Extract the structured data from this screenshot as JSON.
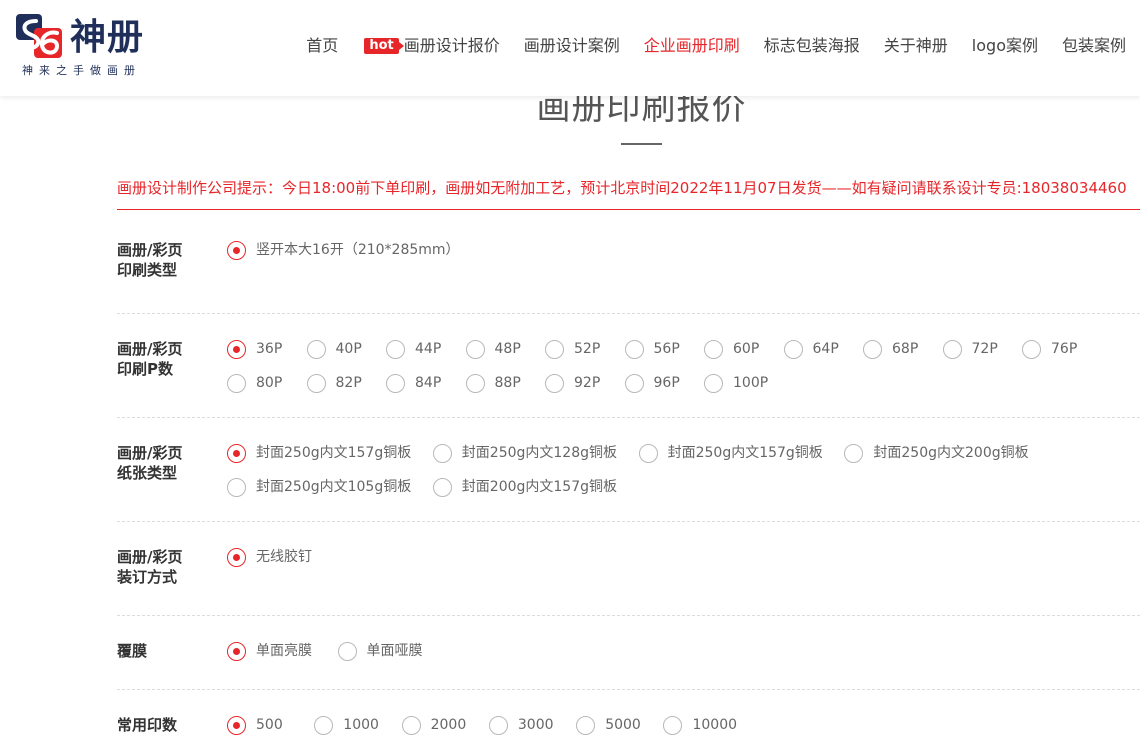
{
  "brand": {
    "name": "神册",
    "slogan": "神来之手做画册",
    "colors": {
      "red": "#e7262a",
      "navy": "#1f2f5a"
    }
  },
  "nav": {
    "items": [
      {
        "label": "首页",
        "active": false
      },
      {
        "label": "画册设计报价",
        "badge": "hot",
        "active": false
      },
      {
        "label": "画册设计案例",
        "active": false
      },
      {
        "label": "企业画册印刷",
        "active": true
      },
      {
        "label": "标志包装海报",
        "active": false
      },
      {
        "label": "关于神册",
        "active": false
      },
      {
        "label": "logo案例",
        "active": false
      },
      {
        "label": "包装案例",
        "active": false
      }
    ]
  },
  "page": {
    "title": "画册印刷报价",
    "notice": "画册设计制作公司提示：今日18:00前下单印刷，画册如无附加工艺，预计北京时间2022年11月07日发货——如有疑问请联系设计专员:18038034460"
  },
  "groups": {
    "print_type": {
      "label_line1": "画册/彩页",
      "label_line2": "印刷类型",
      "selected": "竖开本大16开（210*285mm）",
      "options": [
        "竖开本大16开（210*285mm）"
      ]
    },
    "page_count": {
      "label_line1": "画册/彩页",
      "label_line2": "印刷P数",
      "selected": "36P",
      "options": [
        "36P",
        "40P",
        "44P",
        "48P",
        "52P",
        "56P",
        "60P",
        "64P",
        "68P",
        "72P",
        "76P",
        "80P",
        "82P",
        "84P",
        "88P",
        "92P",
        "96P",
        "100P"
      ]
    },
    "paper_type": {
      "label_line1": "画册/彩页",
      "label_line2": "纸张类型",
      "selected": "封面250g内文157g铜板",
      "options": [
        "封面250g内文157g铜板",
        "封面250g内文128g铜板",
        "封面250g内文157g铜板",
        "封面250g内文200g铜板",
        "封面250g内文105g铜板",
        "封面200g内文157g铜板"
      ]
    },
    "binding": {
      "label_line1": "画册/彩页",
      "label_line2": "装订方式",
      "selected": "无线胶钉",
      "options": [
        "无线胶钉"
      ]
    },
    "laminate": {
      "label_line1": "覆膜",
      "label_line2": "",
      "selected": "单面亮膜",
      "options": [
        "单面亮膜",
        "单面哑膜"
      ]
    },
    "quantity": {
      "label_line1": "常用印数",
      "label_line2": "",
      "selected": "500",
      "options": [
        "500",
        "1000",
        "2000",
        "3000",
        "5000",
        "10000"
      ]
    }
  }
}
